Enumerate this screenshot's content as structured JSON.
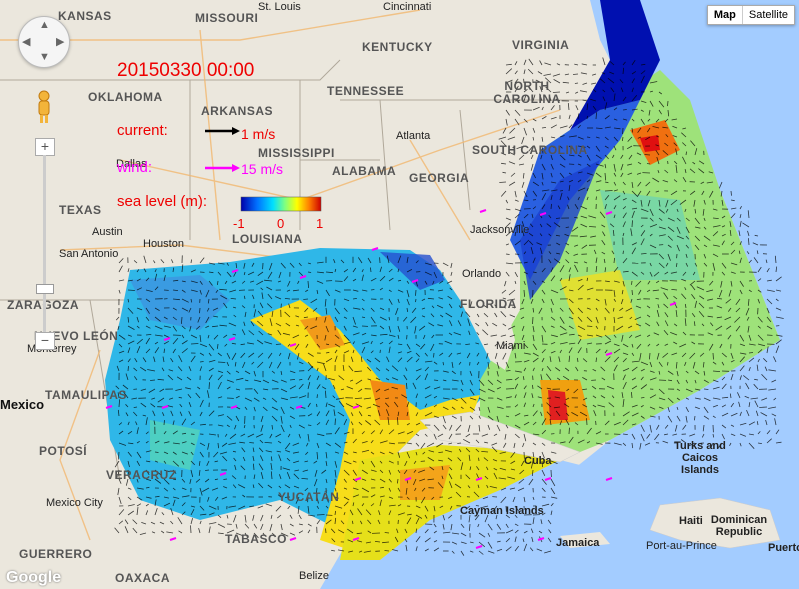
{
  "overlay": {
    "timestamp": "20150330 00:00",
    "current_label": "current:",
    "current_scale": "1 m/s",
    "wind_label": "wind:",
    "wind_scale": "15 m/s",
    "sea_level_label": "sea level (m):",
    "colorbar_ticks": [
      "-1",
      "0",
      "1"
    ],
    "colors": {
      "overlay_text": "#e00000",
      "wind": "#ff00ff",
      "current": "#000000"
    }
  },
  "map_type": {
    "map": "Map",
    "satellite": "Satellite",
    "selected": "Map"
  },
  "controls": {
    "zoom_in": "+",
    "zoom_out": "−",
    "pan_icon": "pan-control-icon",
    "pegman_icon": "pegman-icon"
  },
  "logo": "Google",
  "labels": {
    "states": [
      "KANSAS",
      "MISSOURI",
      "KENTUCKY",
      "VIRGINIA",
      "OKLAHOMA",
      "ARKANSAS",
      "TENNESSEE",
      "NORTH CAROLINA",
      "SOUTH CAROLINA",
      "MISSISSIPPI",
      "ALABAMA",
      "GEORGIA",
      "TEXAS",
      "LOUISIANA",
      "FLORIDA",
      "NUEVO LEÓN",
      "TAMAULIPAS",
      "POTOSÍ",
      "YUCATÁN",
      "TABASCO",
      "GUERRERO",
      "OAXACA",
      "ZARAGOZA",
      "VERACRUZ"
    ],
    "cities": [
      "Cincinnati",
      "St. Louis",
      "Atlanta",
      "Dallas",
      "Austin",
      "Houston",
      "San Antonio",
      "Jacksonville",
      "Orlando",
      "Miami",
      "Monterrey",
      "Mexico City",
      "Belize",
      "Cuba",
      "Jamaica",
      "Haiti",
      "Port-au-Prince",
      "Puerto"
    ],
    "countries": [
      "Mexico",
      "Dominican Republic"
    ],
    "islands": [
      "Turks and Caicos Islands",
      "Cayman Islands"
    ]
  }
}
